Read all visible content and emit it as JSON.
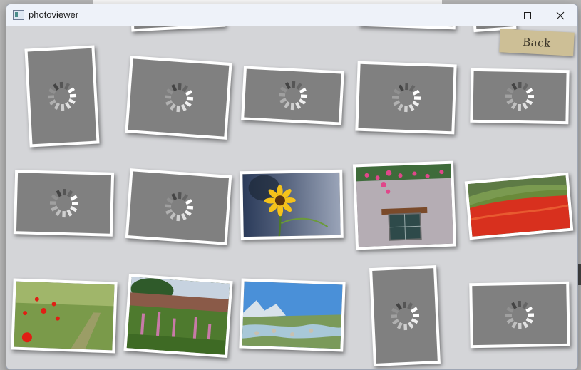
{
  "window": {
    "title": "photoviewer",
    "minimize_icon": "minimize-icon",
    "maximize_icon": "maximize-icon",
    "close_icon": "close-icon"
  },
  "back_button": {
    "label": "Back"
  },
  "colors": {
    "background": "#d4d5d8",
    "placeholder": "#808080",
    "frame": "#ffffff",
    "back_button": "#cdbf96"
  },
  "thumbnails": [
    {
      "state": "loading",
      "icon": "loading-spinner-icon"
    },
    {
      "state": "loading",
      "icon": "loading-spinner-icon"
    },
    {
      "state": "loading",
      "icon": "loading-spinner-icon"
    },
    {
      "state": "loading",
      "icon": "loading-spinner-icon"
    },
    {
      "state": "loading",
      "icon": "loading-spinner-icon"
    },
    {
      "state": "loading",
      "icon": "loading-spinner-icon"
    },
    {
      "state": "loading",
      "icon": "loading-spinner-icon"
    },
    {
      "state": "loaded",
      "subject": "sunflower"
    },
    {
      "state": "loaded",
      "subject": "window-with-flowers"
    },
    {
      "state": "loaded",
      "subject": "poppy-field"
    },
    {
      "state": "loaded",
      "subject": "red-poppies"
    },
    {
      "state": "loaded",
      "subject": "foxglove-garden"
    },
    {
      "state": "loaded",
      "subject": "mountain-stream"
    },
    {
      "state": "loading",
      "icon": "loading-spinner-icon"
    },
    {
      "state": "loading",
      "icon": "loading-spinner-icon"
    }
  ]
}
